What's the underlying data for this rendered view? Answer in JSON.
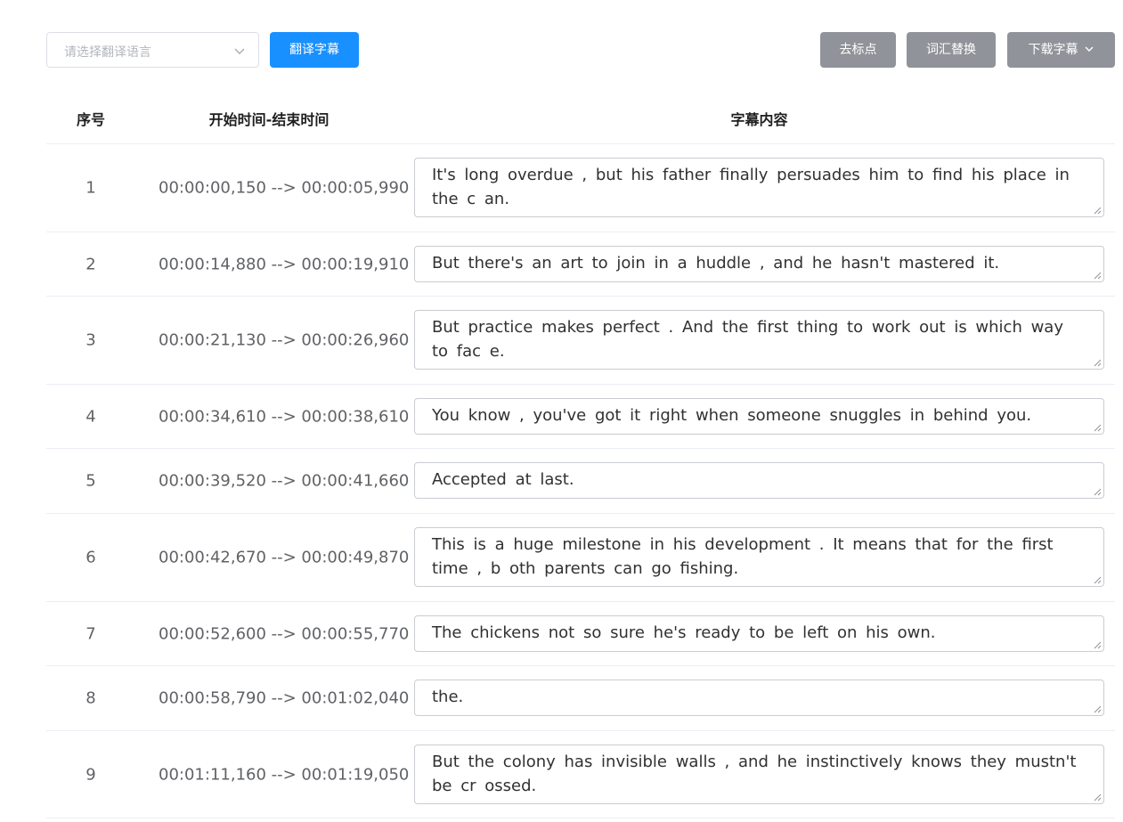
{
  "toolbar": {
    "select_placeholder": "请选择翻译语言",
    "translate_label": "翻译字幕",
    "remove_punct_label": "去标点",
    "vocab_replace_label": "词汇替换",
    "download_label": "下载字幕"
  },
  "colors": {
    "primary": "#1890ff",
    "gray_button": "#909399"
  },
  "table": {
    "headers": {
      "index": "序号",
      "time": "开始时间-结束时间",
      "content": "字幕内容"
    },
    "rows": [
      {
        "index": "1",
        "time": "00:00:00,150 --> 00:00:05,990",
        "text": "It's long overdue , but his father finally persuades him to find his place in the c an."
      },
      {
        "index": "2",
        "time": "00:00:14,880 --> 00:00:19,910",
        "text": "But there's an art to join in a huddle , and he hasn't mastered it."
      },
      {
        "index": "3",
        "time": "00:00:21,130 --> 00:00:26,960",
        "text": "But practice makes perfect . And the first thing to work out is which way to fac e."
      },
      {
        "index": "4",
        "time": "00:00:34,610 --> 00:00:38,610",
        "text": "You know , you've got it right when someone snuggles in behind you."
      },
      {
        "index": "5",
        "time": "00:00:39,520 --> 00:00:41,660",
        "text": "Accepted at last."
      },
      {
        "index": "6",
        "time": "00:00:42,670 --> 00:00:49,870",
        "text": "This is a huge milestone in his development . It means that for the first time , b oth parents can go fishing."
      },
      {
        "index": "7",
        "time": "00:00:52,600 --> 00:00:55,770",
        "text": "The chickens not so sure he's ready to be left on his own."
      },
      {
        "index": "8",
        "time": "00:00:58,790 --> 00:01:02,040",
        "text": "the."
      },
      {
        "index": "9",
        "time": "00:01:11,160 --> 00:01:19,050",
        "text": "But the colony has invisible walls , and he instinctively knows they mustn't be cr ossed."
      }
    ]
  }
}
